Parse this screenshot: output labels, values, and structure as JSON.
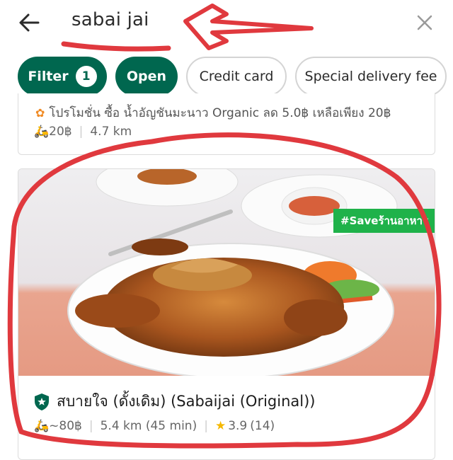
{
  "header": {
    "search_query": "sabai jai",
    "back_icon": "arrow-left-icon",
    "clear_icon": "close-icon"
  },
  "filters": {
    "filter_label": "Filter",
    "filter_count": "1",
    "open_label": "Open",
    "credit_card_label": "Credit card",
    "special_fee_label": "Special delivery fee"
  },
  "previous_card": {
    "promo_text": "โปรโมชั่น ซื้อ น้ำอัญชันมะนาว Organic ลด 5.0฿ เหลือเพียง 20฿",
    "delivery_fee": "20฿",
    "distance": "4.7 km"
  },
  "restaurant": {
    "promo_tag": "#Saveร้านอาหาร",
    "name": "สบายใจ (ดั้งเดิม) (Sabaijai (Original))",
    "delivery_fee": "~80฿",
    "distance_time": "5.4 km (45 min)",
    "rating": "3.9",
    "reviews": "(14)"
  },
  "colors": {
    "accent": "#00674f",
    "promo_green": "#1fb24a",
    "annotation_red": "#e0393e",
    "star": "#f5b800"
  }
}
